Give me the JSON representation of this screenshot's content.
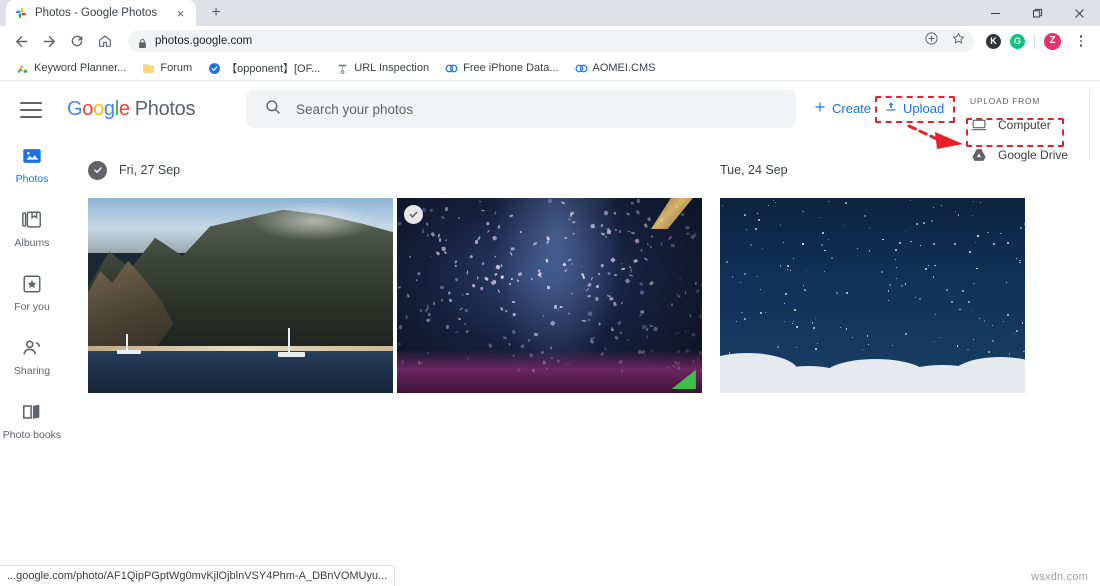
{
  "browser": {
    "tab": {
      "title": "Photos - Google Photos",
      "favicon": "google-photos-pinwheel-icon",
      "close_label": "×"
    },
    "new_tab_label": "+",
    "window_controls": {
      "minimize": "minimize-icon",
      "maximize": "maximize-icon",
      "close": "close-icon"
    },
    "nav": {
      "back": "back-arrow-icon",
      "forward": "forward-arrow-icon",
      "reload": "reload-icon",
      "home": "home-icon"
    },
    "omnibox": {
      "url": "photos.google.com",
      "lock": "lock-icon",
      "share": "share-circle-icon",
      "bookmark": "star-icon"
    },
    "extensions": [
      {
        "name": "extension-k",
        "letter": "K",
        "color": "#32343a"
      },
      {
        "name": "extension-g",
        "letter": "G",
        "color": "#0fc47c"
      }
    ],
    "profile": {
      "letter": "Z",
      "color": "#e8306e"
    },
    "menu": "three-dot-menu-icon",
    "bookmarks": [
      {
        "label": "Keyword Planner...",
        "icon": "google-ads-icon"
      },
      {
        "label": "Forum",
        "icon": "folder-icon"
      },
      {
        "label": "【opponent】[OF...",
        "icon": "blue-check-icon"
      },
      {
        "label": "URL Inspection",
        "icon": "search-console-icon"
      },
      {
        "label": "Free iPhone Data...",
        "icon": "double-o-icon"
      },
      {
        "label": "AOMEI.CMS",
        "icon": "double-o-icon"
      }
    ]
  },
  "app": {
    "menu_button": "hamburger-menu-icon",
    "logo": {
      "google": [
        "G",
        "o",
        "o",
        "g",
        "l",
        "e"
      ],
      "product": "Photos"
    },
    "search": {
      "placeholder": "Search your photos",
      "icon": "search-icon"
    },
    "create": {
      "label": "Create",
      "icon": "plus-icon"
    },
    "upload": {
      "label": "Upload",
      "icon": "upload-icon"
    },
    "upload_menu": {
      "heading": "UPLOAD FROM",
      "items": [
        {
          "label": "Computer",
          "icon": "computer-monitor-icon"
        },
        {
          "label": "Google Drive",
          "icon": "google-drive-icon"
        }
      ]
    },
    "sidebar": [
      {
        "label": "Photos",
        "icon": "photos-icon",
        "active": true
      },
      {
        "label": "Albums",
        "icon": "albums-icon",
        "active": false
      },
      {
        "label": "For you",
        "icon": "for-you-icon",
        "active": false
      },
      {
        "label": "Sharing",
        "icon": "sharing-icon",
        "active": false
      },
      {
        "label": "Photo books",
        "icon": "photo-books-icon",
        "active": false
      }
    ],
    "day_groups": [
      {
        "date_label": "Fri, 27 Sep",
        "select_all_icon": "check-circle-icon",
        "photos": [
          {
            "alt": "coastal-cliffs-ocean-photo",
            "selected": false
          },
          {
            "alt": "concert-confetti-photo",
            "selected": true
          }
        ]
      },
      {
        "date_label": "Tue, 24 Sep",
        "select_all_icon": "",
        "photos": [
          {
            "alt": "starry-night-sky-clouds-photo",
            "selected": false
          }
        ]
      }
    ]
  },
  "annotations": {
    "color": "#e8202a",
    "upload_highlight": "upload-button-highlight",
    "computer_highlight": "computer-menu-item-highlight",
    "arrow": "pointer-arrow"
  },
  "status": {
    "link_url": "...google.com/photo/AF1QipPGptWg0mvKjlOjblnVSY4Phm-A_DBnVOMUyu...",
    "watermark": "wsxdn.com"
  }
}
